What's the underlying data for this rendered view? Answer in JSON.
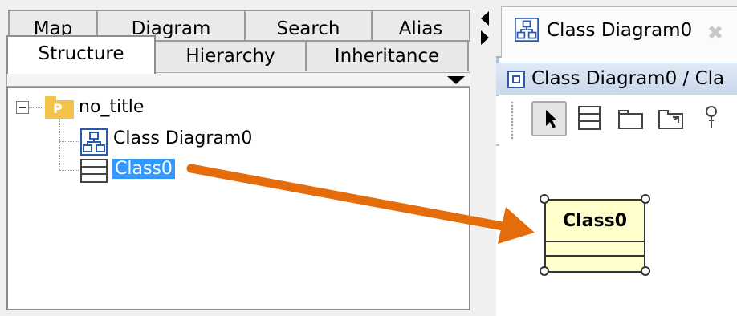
{
  "left_panel": {
    "tabs_row1": [
      "Map",
      "Diagram",
      "Search",
      "Alias"
    ],
    "tabs_row2": [
      "Structure",
      "Hierarchy",
      "Inheritance"
    ],
    "active_tab": "Structure",
    "tree": {
      "root_label": "no_title",
      "root_icon_letter": "P",
      "children": [
        {
          "label": "Class Diagram0",
          "icon": "class-diagram-icon"
        },
        {
          "label": "Class0",
          "icon": "class-icon",
          "selected": true
        }
      ]
    }
  },
  "editor": {
    "tab_label": "Class Diagram0",
    "close_glyph": "✖",
    "header_label": "Class Diagram0 / Cla",
    "palette_tools": [
      "select-pointer-icon",
      "class-tool-icon",
      "package-tool-icon",
      "subsystem-tool-icon",
      "pin-tool-icon"
    ],
    "class_element": {
      "name": "Class0"
    }
  },
  "colors": {
    "selection": "#3399ff",
    "arrow": "#e46c0a",
    "package_icon": "#f3c24b",
    "class_fill": "#ffffcc"
  }
}
